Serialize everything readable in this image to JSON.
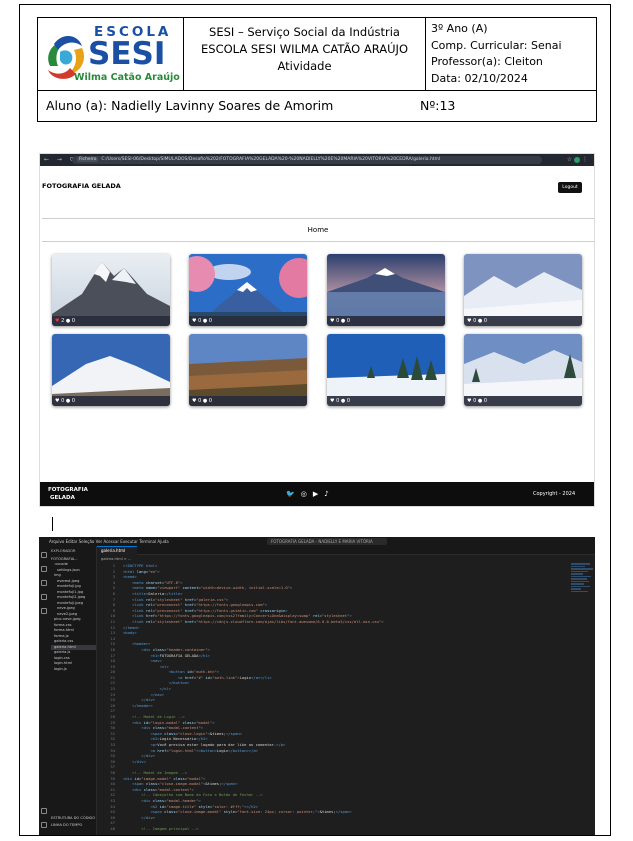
{
  "header": {
    "logo_line1": "ESCOLA",
    "logo_line2": "SESI",
    "logo_line3": "Wilma Catão Araújo",
    "title_line1": "SESI – Serviço Social da Indústria",
    "title_line2": "ESCOLA SESI WILMA CATÃO ARAÚJO",
    "title_line3": "Atividade",
    "grade": "3º Ano (A)",
    "component": "Comp. Curricular: Senai",
    "teacher": "Professor(a): Cleiton",
    "date": "Data: 02/10/2024",
    "student": "Aluno (a): Nadielly Lavinny Soares de Amorim",
    "number": "Nº:13"
  },
  "browser": {
    "url_tag": "Ficheiro",
    "url": "C:/Users/SESI-06/Desktop/SIMULADOS/Desafio%202/FOTOGRAFIA%20GELADA%20-%20NADIELLY%20E%20MARIA%20VITÓRIA%20CEDRA/galeria.html",
    "site_title": "FOTOGRAFIA GELADA",
    "logout_label": "Logout",
    "home_label": "Home",
    "cards": [
      {
        "likes": "2",
        "comments": "0",
        "liked": true
      },
      {
        "likes": "0",
        "comments": "0",
        "liked": false
      },
      {
        "likes": "0",
        "comments": "0",
        "liked": false
      },
      {
        "likes": "0",
        "comments": "0",
        "liked": false
      },
      {
        "likes": "0",
        "comments": "0",
        "liked": false
      },
      {
        "likes": "0",
        "comments": "0",
        "liked": false
      },
      {
        "likes": "0",
        "comments": "0",
        "liked": false
      },
      {
        "likes": "0",
        "comments": "0",
        "liked": false
      }
    ],
    "footer_logo_line1": "FOTOGRAFIA",
    "footer_logo_line2": "GELADA",
    "footer_icons": [
      "twitter-icon",
      "instagram-icon",
      "youtube-icon",
      "tiktok-icon"
    ],
    "copyright": "Copyright - 2024"
  },
  "vscode": {
    "menu": "Arquivo  Editar  Seleção  Ver  Acessar  Executar  Terminal  Ajuda",
    "search": "FOTOGRAFIA GELADA - NADIELLY E MARIA VITÓRIA CEDRA",
    "explorer_title": "EXPLORADOR",
    "project": "FOTOGRAFIA...",
    "files": [
      ".vscode",
      "settings.json",
      "img",
      "everest.jpeg",
      "montefuji.jpg",
      "montefuji1.jpg",
      "montefuji2.jpeg",
      "montefuji.jpeg",
      "neve.jpeg",
      "neve2.jpeg",
      "pico-neve.jpeg",
      "forma.css",
      "forma.html",
      "forma.js",
      "galeria.css",
      "galeria.html",
      "galeria.js",
      "login.css",
      "login.html",
      "login.js"
    ],
    "selected_file": "galeria.html",
    "tab": "galeria.html",
    "breadcrumb": "galeria.html > ...",
    "outline_title": "ESTRUTURA DO CÓDIGO",
    "timeline_title": "LINHA DO TEMPO"
  }
}
